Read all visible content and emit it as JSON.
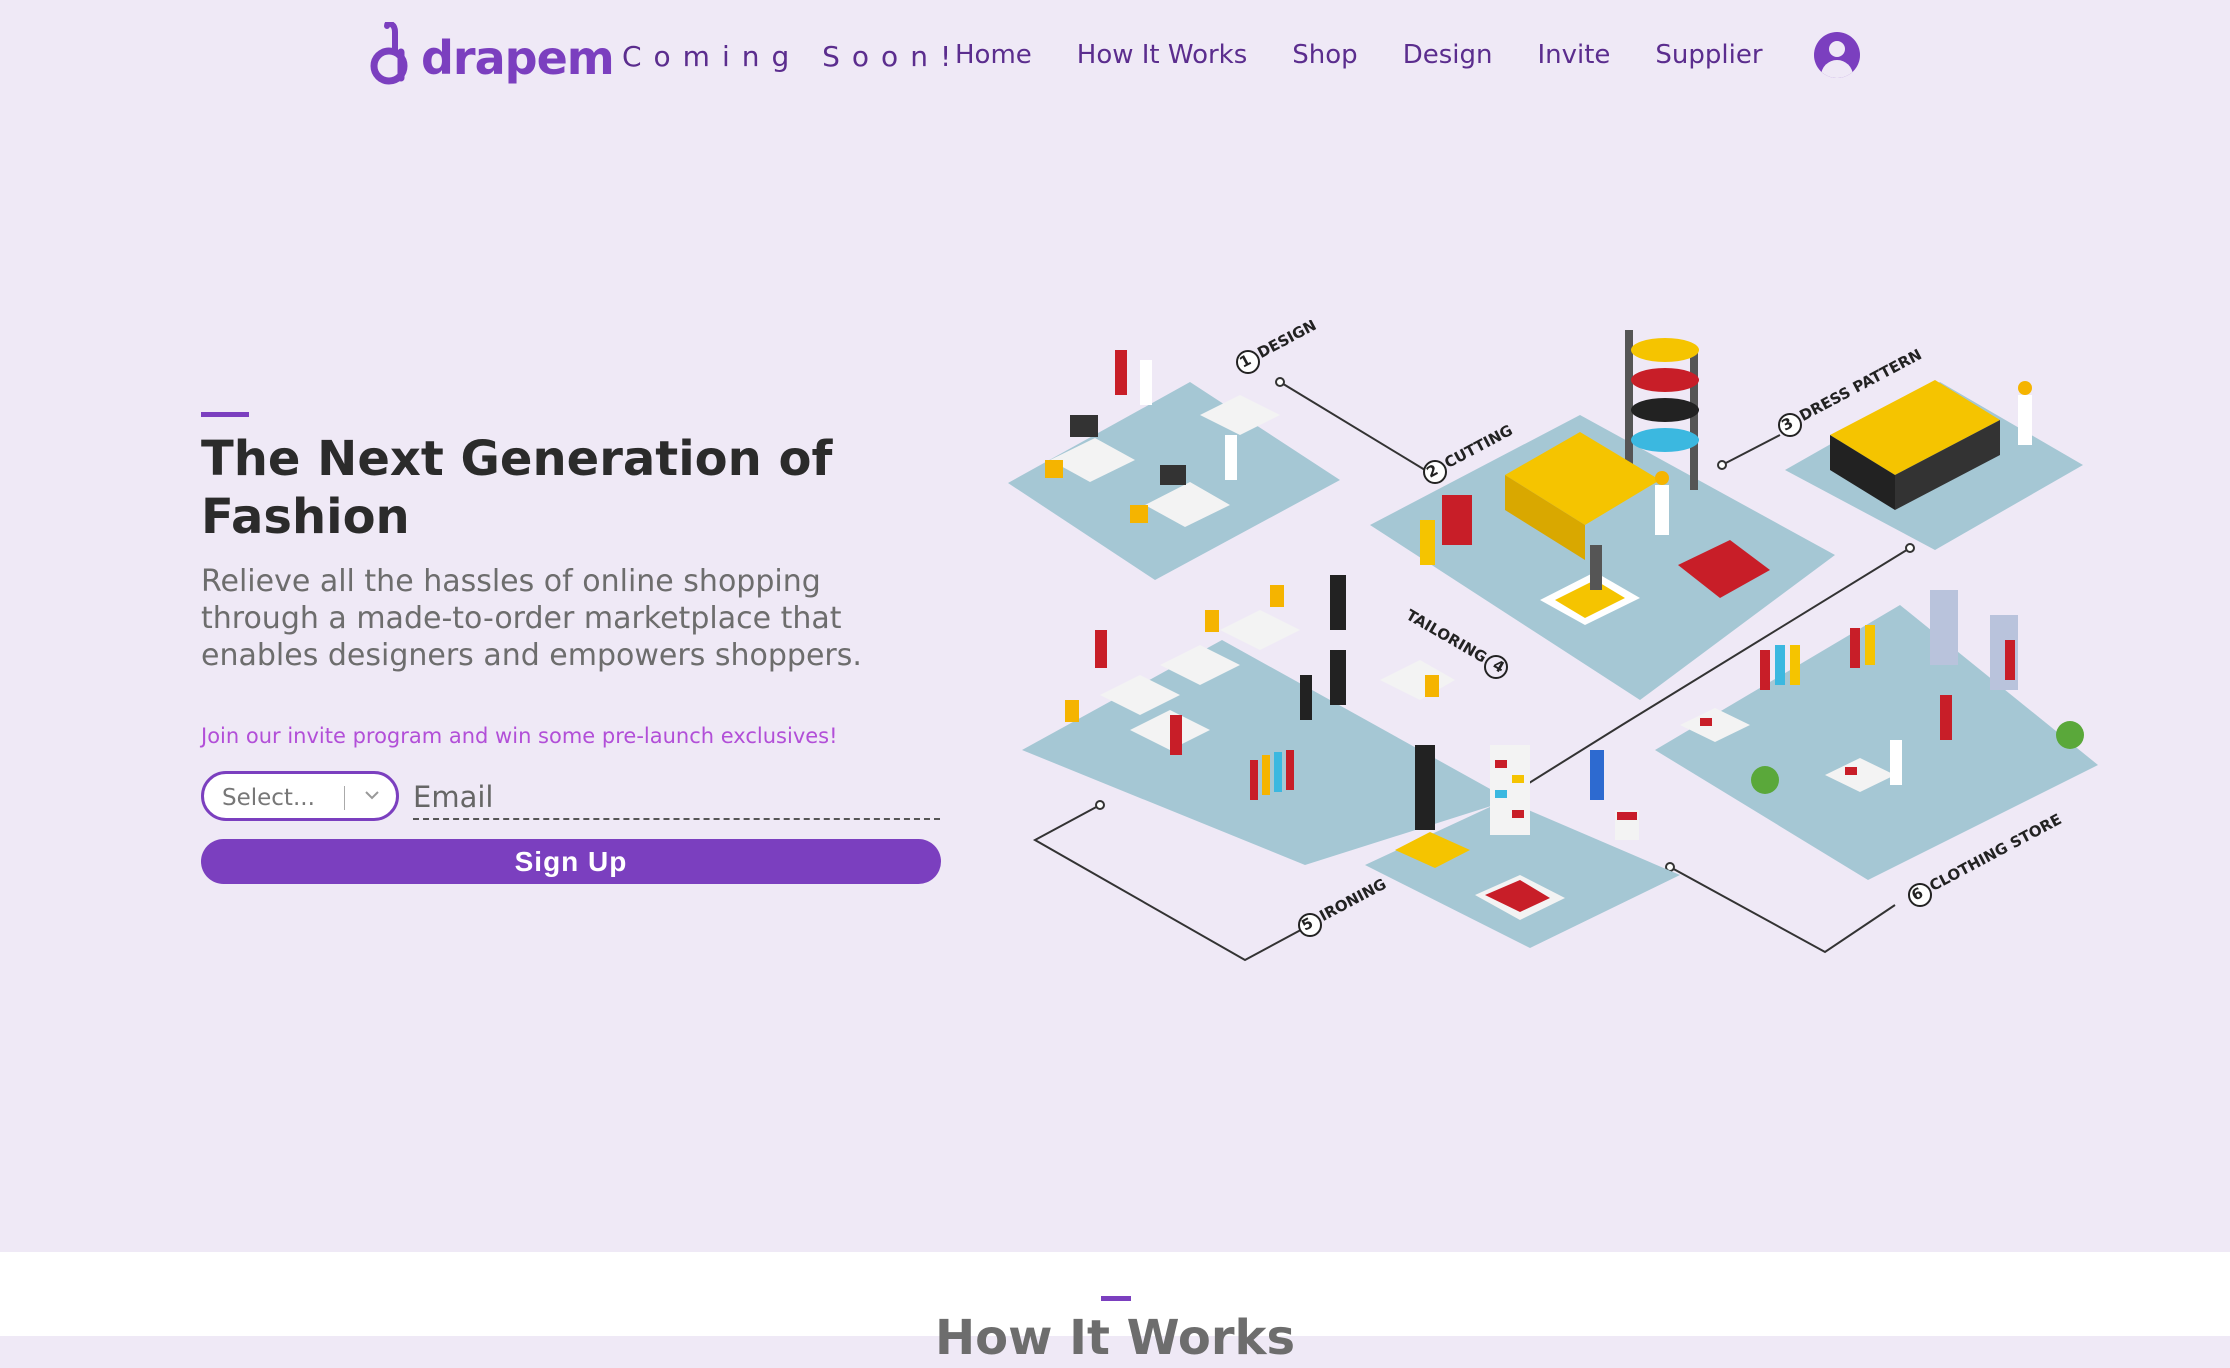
{
  "header": {
    "logo_text": "drapem",
    "coming_soon": "Coming Soon!",
    "nav": [
      {
        "label": "Home"
      },
      {
        "label": "How It Works"
      },
      {
        "label": "Shop"
      },
      {
        "label": "Design"
      },
      {
        "label": "Invite"
      },
      {
        "label": "Supplier"
      }
    ],
    "account_icon": "user-circle-icon"
  },
  "hero": {
    "title": "The Next Generation of Fashion",
    "subtitle": "Relieve all the hassles of online shopping through a made-to-order marketplace that enables designers and empowers shoppers.",
    "invite_text": "Join our invite program and win some pre-launch exclusives!",
    "select_placeholder": "Select...",
    "email_placeholder": "Email",
    "signup_label": "Sign Up"
  },
  "illustration": {
    "steps": [
      {
        "label": "1 DESIGN"
      },
      {
        "label": "2 CUTTING"
      },
      {
        "label": "3 DRESS PATTERN"
      },
      {
        "label": "TAILORING 4"
      },
      {
        "label": "5 IRONING"
      },
      {
        "label": "6 CLOTHING STORE"
      }
    ]
  },
  "section2": {
    "title": "How It Works"
  },
  "colors": {
    "accent": "#7b3fbf",
    "background": "#efe9f6",
    "invite_text": "#b24fd8",
    "floor": "#a5c7d4"
  }
}
